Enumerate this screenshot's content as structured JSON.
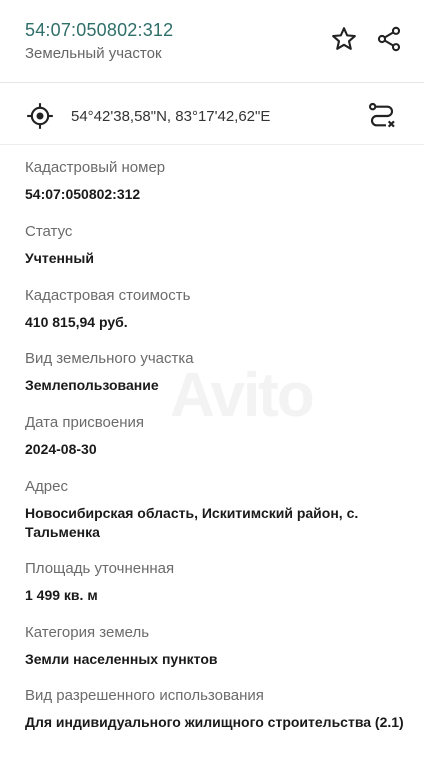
{
  "header": {
    "cadastral_number": "54:07:050802:312",
    "subtitle": "Земельный участок"
  },
  "icons": {
    "star": "star-icon",
    "share": "share-icon",
    "target": "crosshair-target-icon",
    "route": "route-icon"
  },
  "coordinates": "54°42'38,58\"N, 83°17'42,62\"E",
  "fields": [
    {
      "label": "Кадастровый номер",
      "value": "54:07:050802:312"
    },
    {
      "label": "Статус",
      "value": "Учтенный"
    },
    {
      "label": "Кадастровая стоимость",
      "value": "410 815,94 руб."
    },
    {
      "label": "Вид земельного участка",
      "value": "Землепользование"
    },
    {
      "label": "Дата присвоения",
      "value": "2024-08-30"
    },
    {
      "label": "Адрес",
      "value": "Новосибирская область, Искитимский район, с. Тальменка"
    },
    {
      "label": "Площадь уточненная",
      "value": "1 499 кв. м"
    },
    {
      "label": "Категория земель",
      "value": "Земли населенных пунктов"
    },
    {
      "label": "Вид разрешенного использования",
      "value": "Для индивидуального жилищного строительства (2.1)"
    }
  ]
}
